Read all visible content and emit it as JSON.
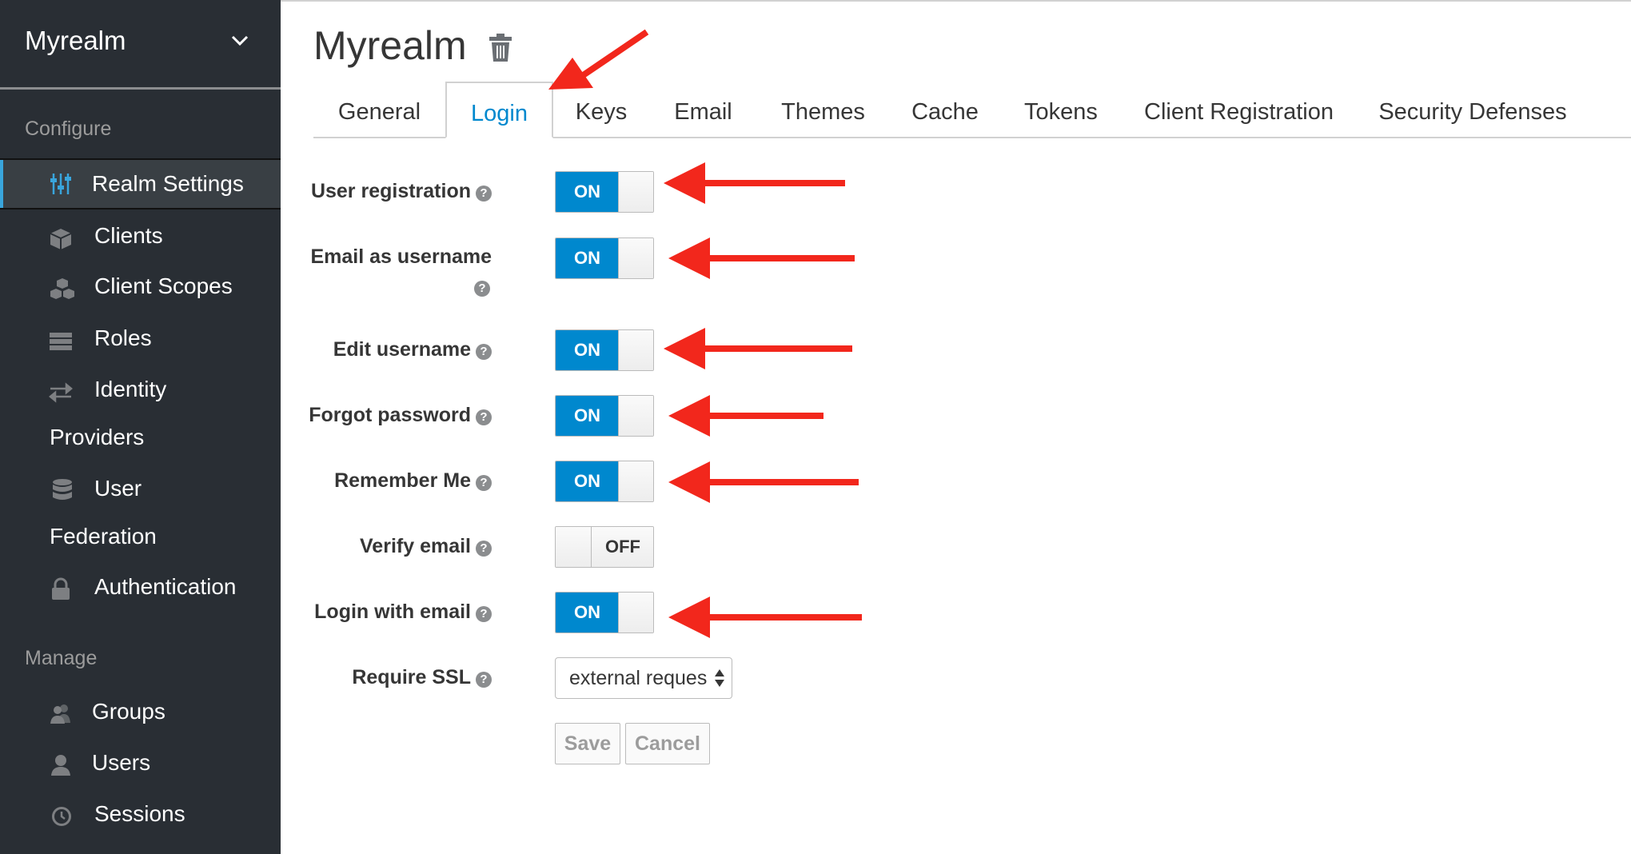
{
  "sidebar": {
    "realm": "Myrealm",
    "configure_heading": "Configure",
    "configure_items": [
      {
        "label": "Realm Settings",
        "icon": "sliders-icon",
        "active": true
      },
      {
        "label": "Clients",
        "icon": "cube-icon"
      },
      {
        "label": "Client Scopes",
        "icon": "cubes-icon"
      },
      {
        "label": "Roles",
        "icon": "list-icon"
      },
      {
        "label": "Identity",
        "label2": "Providers",
        "icon": "exchange-icon"
      },
      {
        "label": "User",
        "label2": "Federation",
        "icon": "database-icon"
      },
      {
        "label": "Authentication",
        "icon": "lock-icon"
      }
    ],
    "manage_heading": "Manage",
    "manage_items": [
      {
        "label": "Groups",
        "icon": "users-icon"
      },
      {
        "label": "Users",
        "icon": "user-icon"
      },
      {
        "label": "Sessions",
        "icon": "clock-icon"
      }
    ]
  },
  "main": {
    "title": "Myrealm",
    "tabs": [
      "General",
      "Login",
      "Keys",
      "Email",
      "Themes",
      "Cache",
      "Tokens",
      "Client Registration",
      "Security Defenses"
    ],
    "active_tab": "Login",
    "settings": [
      {
        "label": "User registration",
        "state": "ON"
      },
      {
        "label": "Email as username",
        "state": "ON"
      },
      {
        "label": "Edit username",
        "state": "ON"
      },
      {
        "label": "Forgot password",
        "state": "ON"
      },
      {
        "label": "Remember Me",
        "state": "ON"
      },
      {
        "label": "Verify email",
        "state": "OFF"
      },
      {
        "label": "Login with email",
        "state": "ON"
      }
    ],
    "require_ssl_label": "Require SSL",
    "require_ssl_value": "external reques",
    "help_glyph": "?",
    "save_label": "Save",
    "cancel_label": "Cancel"
  },
  "colors": {
    "sidebar_bg": "#292e34",
    "accent": "#0088ce",
    "annotation_arrow": "#f2271c"
  }
}
